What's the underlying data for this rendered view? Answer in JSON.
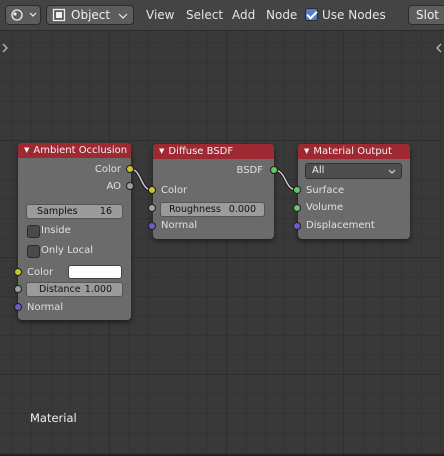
{
  "header": {
    "object_mode": "Object",
    "menus": [
      "View",
      "Select",
      "Add",
      "Node"
    ],
    "use_nodes_label": "Use Nodes",
    "use_nodes_checked": true,
    "slot_label": "Slot"
  },
  "editor": {
    "material_label": "Material"
  },
  "nodes": {
    "ao": {
      "title": "Ambient Occlusion",
      "out_color": "Color",
      "out_ao": "AO",
      "samples_label": "Samples",
      "samples_value": "16",
      "inside_label": "Inside",
      "only_local_label": "Only Local",
      "in_color": "Color",
      "distance_label": "Distance",
      "distance_value": "1.000",
      "in_normal": "Normal"
    },
    "diffuse": {
      "title": "Diffuse BSDF",
      "out_bsdf": "BSDF",
      "in_color": "Color",
      "roughness_label": "Roughness",
      "roughness_value": "0.000",
      "in_normal": "Normal"
    },
    "output": {
      "title": "Material Output",
      "target": "All",
      "in_surface": "Surface",
      "in_volume": "Volume",
      "in_displacement": "Displacement"
    }
  },
  "colors": {
    "node_header": "#9f2933",
    "socket_color": "#c7c729",
    "socket_float": "#a1a1a1",
    "socket_vector": "#6363c7",
    "socket_shader": "#63c763"
  }
}
